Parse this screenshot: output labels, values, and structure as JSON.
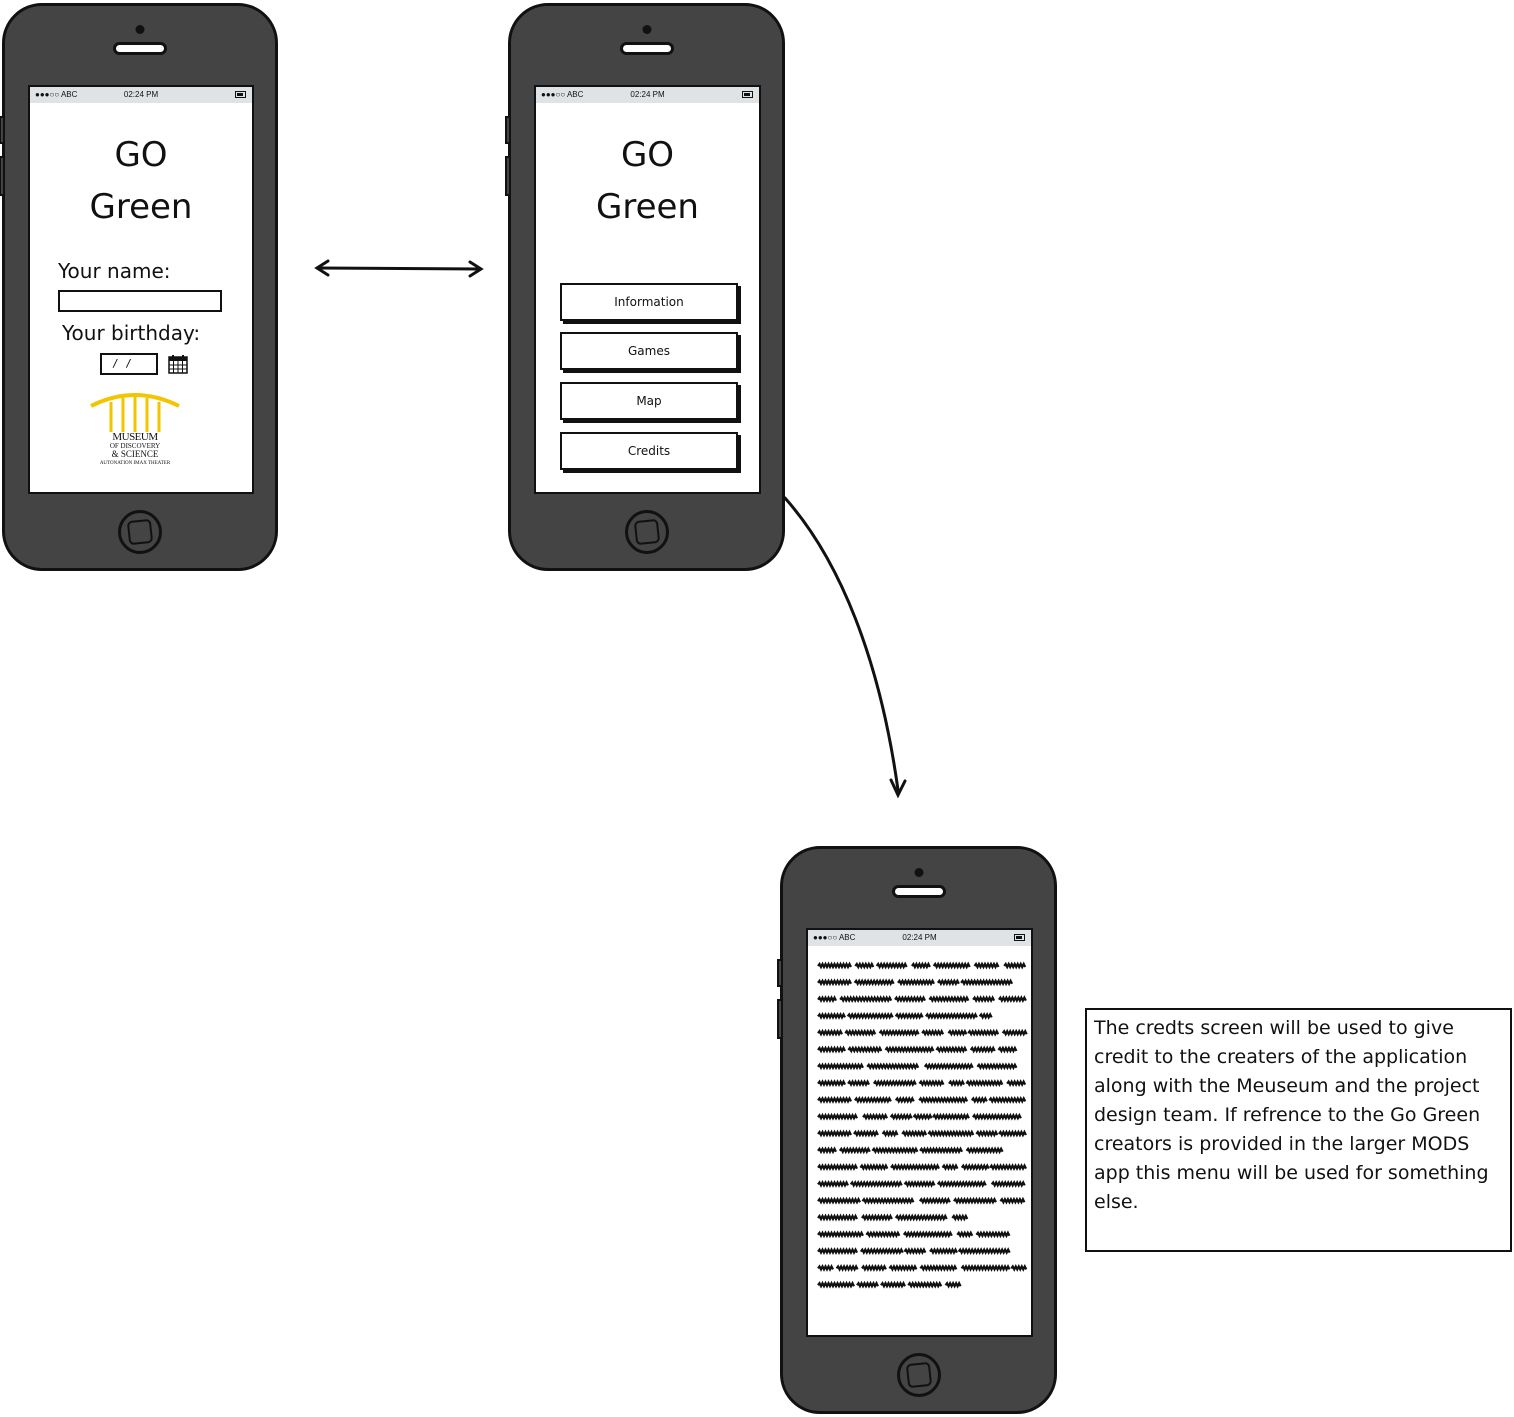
{
  "status_bar": {
    "carrier": "●●●○○ ABC",
    "time": "02:24 PM"
  },
  "screen1": {
    "title_line1": "GO",
    "title_line2": "Green",
    "name_label": "Your name:",
    "name_value": "",
    "birthday_label": "Your birthday:",
    "birthday_value": "/ /",
    "logo": {
      "line1": "MUSEUM",
      "line2": "OF DISCOVERY",
      "line3": "& SCIENCE",
      "line4": "AUTONATION IMAX THEATER",
      "accent_color": "#f2c500"
    }
  },
  "screen2": {
    "title_line1": "GO",
    "title_line2": "Green",
    "buttons": [
      "Information",
      "Games",
      "Map",
      "Credits"
    ]
  },
  "screen3": {
    "content": "placeholder-scribble-text"
  },
  "note": {
    "text": "The credts screen will be used to give credit to the creaters of the application along with the Meuseum and the project design team. If refrence to the Go Green creators is provided in the larger MODS app this menu will be used for something else."
  }
}
